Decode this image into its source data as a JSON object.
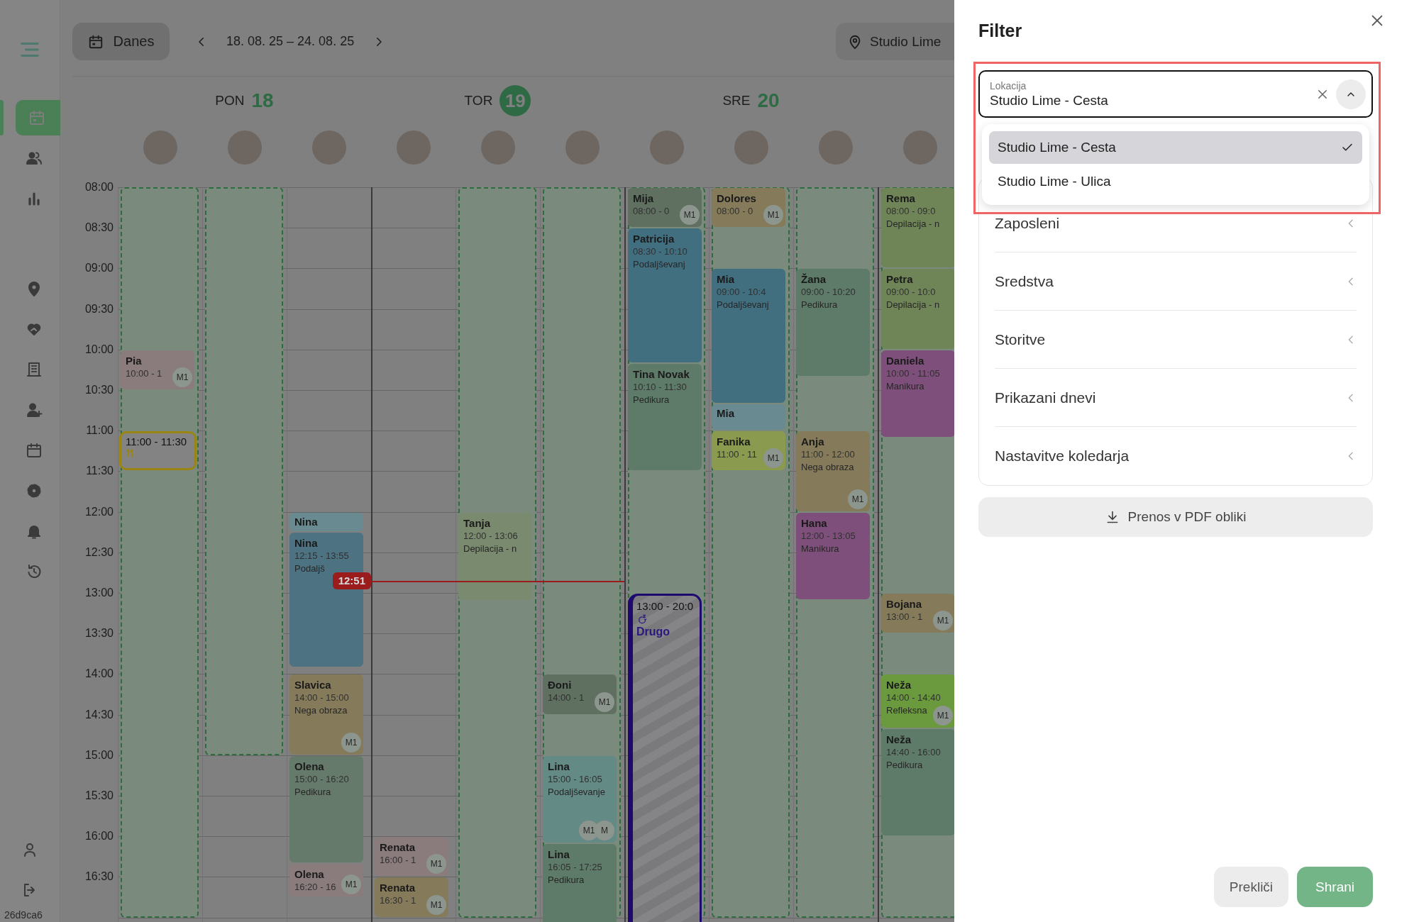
{
  "sidebar": {
    "sections": [
      {
        "items": [
          {
            "kind": "calendar",
            "selected": true
          },
          {
            "kind": "clients",
            "selected": false
          },
          {
            "kind": "stats",
            "selected": false
          }
        ]
      },
      {
        "items": [
          {
            "kind": "location",
            "selected": false
          },
          {
            "kind": "care",
            "selected": false
          },
          {
            "kind": "building",
            "selected": false
          },
          {
            "kind": "add-user",
            "selected": false
          },
          {
            "kind": "schedule",
            "selected": false
          },
          {
            "kind": "settings",
            "selected": false
          },
          {
            "kind": "notifications",
            "selected": false
          },
          {
            "kind": "history",
            "selected": false
          }
        ]
      }
    ],
    "bottom_items": [
      {
        "kind": "profile"
      },
      {
        "kind": "logout"
      }
    ],
    "version": "26d9ca6"
  },
  "toolbar": {
    "today_button": "Danes",
    "date_range": "18. 08. 25 – 24. 08. 25",
    "location_button": "Studio Lime"
  },
  "time_labels": [
    "08:00",
    "08:30",
    "09:00",
    "09:30",
    "10:00",
    "10:30",
    "11:00",
    "11:30",
    "12:00",
    "12:30",
    "13:00",
    "13:30",
    "14:00",
    "14:30",
    "15:00",
    "15:30",
    "16:00",
    "16:30"
  ],
  "now_marker": {
    "label": "12:51"
  },
  "days": [
    {
      "weekday": "PON",
      "date": "18",
      "today": false,
      "columns": [
        {
          "working_hours": true,
          "events": [
            {
              "kind": "appointment",
              "client": "Pia",
              "time": "10:00 - 1",
              "badges": [
                "M1"
              ],
              "color": "#8a7b7d"
            },
            {
              "kind": "break",
              "time": "11:00 - 11:30"
            }
          ]
        },
        {
          "working_hours": true
        },
        {
          "working_hours": false,
          "events": [
            {
              "kind": "appointment",
              "client": "Nina",
              "color": "#6a8a92"
            },
            {
              "kind": "appointment",
              "client": "Nina",
              "time": "12:15 - 13:55",
              "service": "Podaljš",
              "color": "#4d7282"
            },
            {
              "kind": "appointment",
              "client": "Slavica",
              "time": "14:00 - 15:00",
              "service": "Nega obraza",
              "badges": [
                "M1"
              ],
              "color": "#857a5a"
            },
            {
              "kind": "appointment",
              "client": "Olena",
              "time": "15:00 - 16:20",
              "service": "Pedikura",
              "color": "#667a6b"
            },
            {
              "kind": "appointment",
              "client": "Olena",
              "time": "16:20 - 16",
              "badges": [
                "M1"
              ],
              "color": "#8a7b7d"
            }
          ]
        }
      ]
    },
    {
      "weekday": "TOR",
      "date": "19",
      "today": true,
      "columns": [
        {
          "working_hours": false,
          "events": [
            {
              "kind": "appointment",
              "client": "Renata",
              "time": "16:00 - 1",
              "badges": [
                "M1"
              ],
              "color": "#8a7b7d"
            },
            {
              "kind": "appointment",
              "client": "Renata",
              "time": "16:30 - 1",
              "badges": [
                "M1"
              ],
              "color": "#857a5a"
            }
          ]
        },
        {
          "working_hours": true,
          "events": [
            {
              "kind": "appointment",
              "client": "Tanja",
              "time": "12:00 - 13:06",
              "service": "Depilacija - n",
              "color": "#7a8a6e"
            }
          ]
        },
        {
          "working_hours": true,
          "events": [
            {
              "kind": "appointment",
              "client": "Đoni",
              "time": "14:00 - 1",
              "badges": [
                "M1"
              ],
              "color": "#5f6f60"
            },
            {
              "kind": "appointment",
              "client": "Lina",
              "time": "15:00 - 16:05",
              "service": "Podaljševanje",
              "badges": [
                "M1",
                "M"
              ],
              "color": "#648a85"
            },
            {
              "kind": "appointment",
              "client": "Lina",
              "time": "16:05 - 17:25",
              "service": "Pedikura",
              "color": "#5e7a68"
            }
          ]
        }
      ]
    },
    {
      "weekday": "SRE",
      "date": "20",
      "today": false,
      "columns": [
        {
          "working_hours": true,
          "events": [
            {
              "kind": "appointment",
              "client": "Mija",
              "time": "08:00 - 0",
              "badges": [
                "M1"
              ],
              "color": "#5f6f60"
            },
            {
              "kind": "appointment",
              "client": "Patricija",
              "time": "08:30 - 10:10",
              "service": "Podaljševanj",
              "color": "#426f80"
            },
            {
              "kind": "appointment",
              "client": "Tina Novak",
              "time": "10:10 - 11:30",
              "service": "Pedikura",
              "color": "#5e7a68"
            },
            {
              "kind": "blocked",
              "time": "13:00 - 20:0",
              "reason": "Drugo"
            }
          ]
        },
        {
          "working_hours": true,
          "events": [
            {
              "kind": "appointment",
              "client": "Dolores",
              "time": "08:00 - 0",
              "badges": [
                "M1"
              ],
              "color": "#857a5a"
            },
            {
              "kind": "appointment",
              "client": "Mia",
              "time": "09:00 - 10:4",
              "service": "Podaljševanj",
              "color": "#426f80"
            },
            {
              "kind": "appointment",
              "client": "Mia",
              "color": "#6a8a92"
            },
            {
              "kind": "appointment",
              "client": "Fanika",
              "time": "11:00 - 11",
              "badges": [
                "M1"
              ],
              "color": "#8a9a4f"
            }
          ]
        },
        {
          "working_hours": true,
          "events": [
            {
              "kind": "appointment",
              "client": "Žana",
              "time": "09:00 - 10:20",
              "service": "Pedikura",
              "color": "#5e7a68"
            },
            {
              "kind": "appointment",
              "client": "Anja",
              "time": "11:00 - 12:00",
              "service": "Nega obraza",
              "badges": [
                "M1"
              ],
              "color": "#857a5a"
            },
            {
              "kind": "appointment",
              "client": "Hana",
              "time": "12:00 - 13:05",
              "service": "Manikura",
              "color": "#7d4f7a"
            }
          ]
        }
      ]
    },
    {
      "columns": [
        {
          "working_hours": true,
          "events": [
            {
              "kind": "appointment",
              "client": "Rema",
              "time": "08:00 - 09:0",
              "service": "Depilacija - n",
              "color": "#6f8558"
            },
            {
              "kind": "appointment",
              "client": "Petra",
              "time": "09:00 - 10:0",
              "service": "Depilacija - n",
              "color": "#6f8558"
            },
            {
              "kind": "appointment",
              "client": "Daniela",
              "time": "10:00 - 11:05",
              "service": "Manikura",
              "color": "#7d4f7a"
            },
            {
              "kind": "appointment",
              "client": "Bojana",
              "time": "13:00 - 1",
              "badges": [
                "M1"
              ],
              "color": "#857a5a"
            },
            {
              "kind": "appointment",
              "client": "Neža",
              "time": "14:00 - 14:40",
              "service": "Refleksna",
              "badges": [
                "M1"
              ],
              "color": "#6b9a3e"
            },
            {
              "kind": "appointment",
              "client": "Neža",
              "time": "14:40 - 16:00",
              "service": "Pedikura",
              "color": "#5e7a68"
            }
          ]
        }
      ]
    }
  ],
  "filter_panel": {
    "title": "Filter",
    "location_field": {
      "label": "Lokacija",
      "value": "Studio Lime - Cesta",
      "expanded": true,
      "highlighted": true,
      "options": [
        {
          "label": "Studio Lime - Cesta",
          "selected": true
        },
        {
          "label": "Studio Lime - Ulica",
          "selected": false
        }
      ]
    },
    "sections": [
      "Zaposleni",
      "Sredstva",
      "Storitve",
      "Prikazani dnevi",
      "Nastavitve koledarja"
    ],
    "pdf_button": "Prenos v PDF obliki",
    "cancel_button": "Prekliči",
    "save_button": "Shrani"
  }
}
